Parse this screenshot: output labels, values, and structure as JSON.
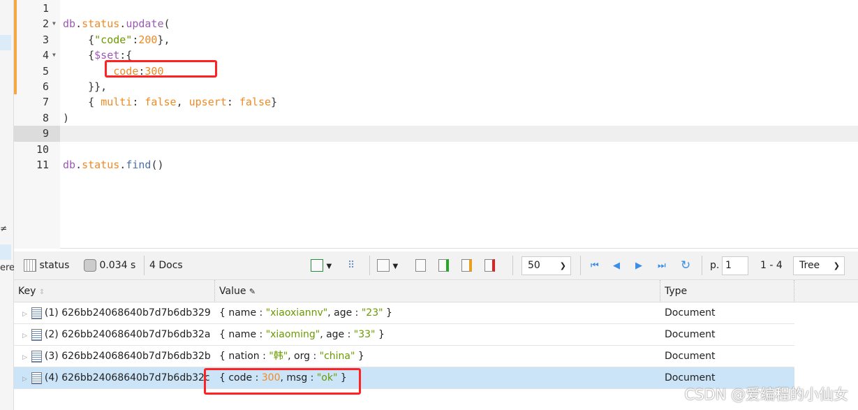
{
  "sidebar": {
    "partial_text": "ere",
    "partial_text2": "≠"
  },
  "editor": {
    "lines": [
      {
        "n": "1",
        "fold": false,
        "tokens": []
      },
      {
        "n": "2",
        "fold": true,
        "tokens": [
          [
            "p",
            "db"
          ],
          [
            "",
            "."
          ],
          [
            "o",
            "status"
          ],
          [
            "",
            "."
          ],
          [
            "p",
            "update"
          ],
          [
            "",
            "("
          ]
        ]
      },
      {
        "n": "3",
        "fold": false,
        "tokens": [
          [
            "",
            "    {"
          ],
          [
            "g",
            "\"code\""
          ],
          [
            "",
            ":"
          ],
          [
            "o",
            "200"
          ],
          [
            "",
            "},"
          ]
        ]
      },
      {
        "n": "4",
        "fold": true,
        "tokens": [
          [
            "",
            "    {"
          ],
          [
            "p",
            "$set"
          ],
          [
            "",
            ":{"
          ]
        ]
      },
      {
        "n": "5",
        "fold": false,
        "tokens": [
          [
            "",
            "        "
          ],
          [
            "o",
            "code"
          ],
          [
            "",
            ":"
          ],
          [
            "o",
            "300"
          ]
        ]
      },
      {
        "n": "6",
        "fold": false,
        "tokens": [
          [
            "",
            "    }},"
          ]
        ]
      },
      {
        "n": "7",
        "fold": false,
        "tokens": [
          [
            "",
            "    { "
          ],
          [
            "o",
            "multi"
          ],
          [
            "",
            ": "
          ],
          [
            "o",
            "false"
          ],
          [
            "",
            ", "
          ],
          [
            "o",
            "upsert"
          ],
          [
            "",
            ": "
          ],
          [
            "o",
            "false"
          ],
          [
            "",
            "}"
          ]
        ]
      },
      {
        "n": "8",
        "fold": false,
        "tokens": [
          [
            "",
            ")"
          ]
        ]
      },
      {
        "n": "9",
        "fold": false,
        "tokens": [],
        "current": true
      },
      {
        "n": "10",
        "fold": false,
        "tokens": []
      },
      {
        "n": "11",
        "fold": false,
        "tokens": [
          [
            "p",
            "db"
          ],
          [
            "",
            "."
          ],
          [
            "o",
            "status"
          ],
          [
            "",
            "."
          ],
          [
            "b",
            "find"
          ],
          [
            "",
            "()"
          ]
        ]
      }
    ]
  },
  "toolbar": {
    "collection": "status",
    "time": "0.034 s",
    "docs": "4 Docs",
    "page_size": "50",
    "page_label": "p.",
    "page": "1",
    "range": "1 - 4",
    "view": "Tree"
  },
  "table": {
    "headers": {
      "key": "Key",
      "value": "Value",
      "type": "Type"
    },
    "rows": [
      {
        "key": "(1) 626bb24068640b7d7b6db329",
        "value": [
          [
            "",
            "{ name : "
          ],
          [
            "g",
            "\"xiaoxiannv\""
          ],
          [
            "",
            ", age : "
          ],
          [
            "g",
            "\"23\""
          ],
          [
            "",
            " }"
          ]
        ],
        "type": "Document"
      },
      {
        "key": "(2) 626bb24068640b7d7b6db32a",
        "value": [
          [
            "",
            "{ name : "
          ],
          [
            "g",
            "\"xiaoming\""
          ],
          [
            "",
            ", age : "
          ],
          [
            "g",
            "\"33\""
          ],
          [
            "",
            " }"
          ]
        ],
        "type": "Document"
      },
      {
        "key": "(3) 626bb24068640b7d7b6db32b",
        "value": [
          [
            "",
            "{ nation : "
          ],
          [
            "g",
            "\"韩\""
          ],
          [
            "",
            ", org : "
          ],
          [
            "g",
            "\"china\""
          ],
          [
            "",
            " }"
          ]
        ],
        "type": "Document"
      },
      {
        "key": "(4) 626bb24068640b7d7b6db32c",
        "value": [
          [
            "",
            "{ code : "
          ],
          [
            "o",
            "300"
          ],
          [
            "",
            ", msg : "
          ],
          [
            "g",
            "\"ok\""
          ],
          [
            "",
            " }"
          ]
        ],
        "type": "Document",
        "selected": true
      }
    ]
  },
  "watermark": "CSDN @爱编程的小仙女",
  "colors": {
    "accent": "#f5a742",
    "selection": "#cce4f7",
    "highlight_box": "#ff2222"
  }
}
